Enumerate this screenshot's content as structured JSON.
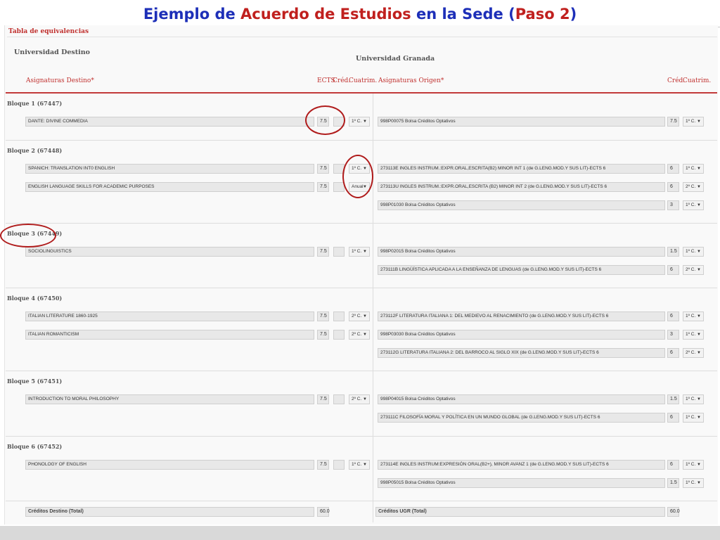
{
  "slide": {
    "title_parts": [
      {
        "text": "Ejemplo de ",
        "color": "blue"
      },
      {
        "text": "Acuerdo de Estudios",
        "color": "red"
      },
      {
        "text": " en la Sede (",
        "color": "blue"
      },
      {
        "text": "Paso 2",
        "color": "red"
      },
      {
        "text": ")",
        "color": "blue"
      }
    ]
  },
  "section_title": "Tabla de equivalencias",
  "universities": {
    "destination": "Universidad Destino",
    "origin": "Universidad Granada"
  },
  "headers": {
    "asignaturas_destino": "Asignaturas Destino*",
    "ects": "ECTS",
    "cred": "Créd.",
    "cuatrim": "Cuatrim.",
    "asignaturas_origen": "Asignaturas Origen*",
    "cred_origen": "Créd.",
    "cuatrim_origen": "Cuatrim."
  },
  "blocks": [
    {
      "label": "Bloque 1 (67447)"
    },
    {
      "label": "Bloque 2 (67448)"
    },
    {
      "label": "Bloque 3 (67449)"
    },
    {
      "label": "Bloque 4 (67450)"
    },
    {
      "label": "Bloque 5 (67451)"
    },
    {
      "label": "Bloque 6 (67452)"
    }
  ],
  "dest_rows": [
    {
      "subject": "DANTE: DIVINE COMMEDIA",
      "ects": "7.5",
      "cuatrim": "1º C."
    },
    {
      "subject": "SPANICH: TRANSLATION INT0 ENGLISH",
      "ects": "7.5",
      "cuatrim": "1º C."
    },
    {
      "subject": "ENGLISH LANGUAGE SKILLS FOR ACADEMIC PURPOSES",
      "ects": "7.5",
      "cuatrim": "Anual"
    },
    {
      "subject": "SOCIOLINGUISTICS",
      "ects": "7.5",
      "cuatrim": "1º C."
    },
    {
      "subject": "ITALIAN LITERATURE 1860-1925",
      "ects": "7.5",
      "cuatrim": "2º C."
    },
    {
      "subject": "ITALIAN ROMANTICISM",
      "ects": "7.5",
      "cuatrim": "2º C."
    },
    {
      "subject": "INTRODUCTION TO MORAL PHILOSOPHY",
      "ects": "7.5",
      "cuatrim": "2º C."
    },
    {
      "subject": "PHONOLOGY OF ENGLISH",
      "ects": "7.5",
      "cuatrim": "1º C."
    }
  ],
  "origin_rows": [
    {
      "subject": "998P00075 Bolsa Créditos Optativos",
      "cred": "7.5",
      "cuatrim": "1º C."
    },
    {
      "subject": "273113E INGLES INSTRUM.:EXPR.ORAL,ESCRITA(B2) MINOR INT 1 (de G.LENG.MOD.Y SUS LIT)-ECTS 6",
      "cred": "6",
      "cuatrim": "1º C."
    },
    {
      "subject": "273113U INGLES INSTRUM.:EXPR.ORAL,ESCRITA (B2) MINOR INT 2 (de G.LENG.MOD.Y SUS LIT)-ECTS 6",
      "cred": "6",
      "cuatrim": "2º C."
    },
    {
      "subject": "998P01030 Bolsa Créditos Optativos",
      "cred": "3",
      "cuatrim": "1º C."
    },
    {
      "subject": "998P02015 Bolsa Créditos Optativos",
      "cred": "1.5",
      "cuatrim": "1º C."
    },
    {
      "subject": "273111B LINGÜÍSTICA APLICADA A LA ENSEÑANZA DE LENGUAS (de G.LENG.MOD.Y SUS LIT)-ECTS 6",
      "cred": "6",
      "cuatrim": "2º C."
    },
    {
      "subject": "273112F LITERATURA ITALIANA 1: DEL MEDIEVO AL RENACIMIENTO (de G.LENG.MOD.Y SUS LIT)-ECTS 6",
      "cred": "6",
      "cuatrim": "1º C."
    },
    {
      "subject": "998P03030 Bolsa Créditos Optativos",
      "cred": "3",
      "cuatrim": "1º C."
    },
    {
      "subject": "273112G LITERATURA ITALIANA 2: DEL BARROCO AL SIGLO XIX (de G.LENG.MOD.Y SUS LIT)-ECTS 6",
      "cred": "6",
      "cuatrim": "2º C."
    },
    {
      "subject": "998P04015 Bolsa Créditos Optativos",
      "cred": "1.5",
      "cuatrim": "1º C."
    },
    {
      "subject": "273111C FILOSOFÍA MORAL Y POLÍTICA EN UN MUNDO GLOBAL (de G.LENG.MOD.Y SUS LIT)-ECTS 6",
      "cred": "6",
      "cuatrim": "1º C."
    },
    {
      "subject": "273114E INGLES INSTRUM:EXPRESIÓN ORAL(B2+), MINOR AVANZ 1 (de G.LENG.MOD.Y SUS LIT)-ECTS 6",
      "cred": "6",
      "cuatrim": "1º C."
    },
    {
      "subject": "998P05015 Bolsa Créditos Optativos",
      "cred": "1.5",
      "cuatrim": "1º C."
    }
  ],
  "totals": {
    "dest_label": "Créditos Destino (Total)",
    "dest_value": "60.0",
    "origin_label": "Créditos UGR (Total)",
    "origin_value": "60.0"
  },
  "dropdown_arrow": "▼",
  "colors": {
    "title_blue": "#1d2fb8",
    "title_red": "#c0201e",
    "header_red": "#c0302e",
    "circle": "#b01c1c"
  }
}
